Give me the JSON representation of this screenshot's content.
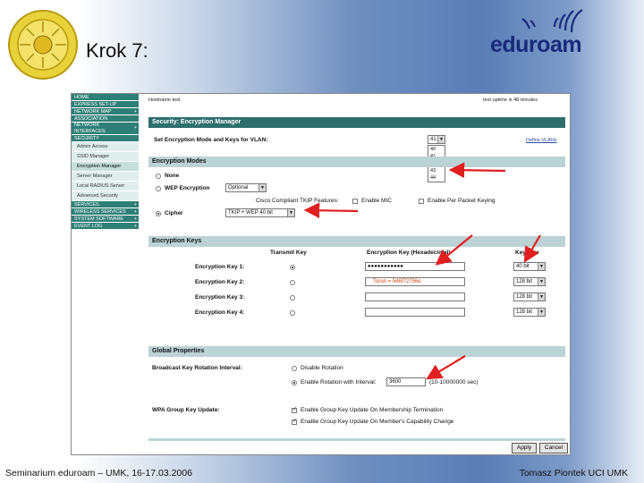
{
  "slide": {
    "title": "Krok 7:",
    "brand": "eduroam",
    "footer_left": "Seminarium eduroam – UMK, 16-17.03.2006",
    "footer_right": "Tomasz Piontek UCI UMK"
  },
  "sidebar": {
    "items": [
      {
        "label": "HOME",
        "plus": ""
      },
      {
        "label": "EXPRESS SET-UP",
        "plus": ""
      },
      {
        "label": "NETWORK MAP",
        "plus": "+"
      },
      {
        "label": "ASSOCIATION",
        "plus": ""
      },
      {
        "label": "NETWORK INTERFACES",
        "plus": "+"
      },
      {
        "label": "SECURITY",
        "plus": ""
      }
    ],
    "sub_items": [
      {
        "label": "Admin Access"
      },
      {
        "label": "SSID Manager"
      },
      {
        "label": "Encryption Manager"
      },
      {
        "label": "Server Manager"
      },
      {
        "label": "Local RADIUS Server"
      },
      {
        "label": "Advanced Security"
      }
    ],
    "items_bottom": [
      {
        "label": "SERVICES",
        "plus": "+"
      },
      {
        "label": "WIRELESS SERVICES",
        "plus": "+"
      },
      {
        "label": "SYSTEM SOFTWARE",
        "plus": "+"
      },
      {
        "label": "EVENT LOG",
        "plus": "+"
      }
    ]
  },
  "header": {
    "hostname": "Hostname  test",
    "uptime": "test uptime is 48 minutes"
  },
  "security": {
    "title": "Security: Encryption Manager",
    "vlan_label": "Set Encryption Mode and Keys for VLAN:",
    "vlan_selected": "41",
    "vlan_options": [
      "40",
      "41",
      "42",
      "43",
      "44"
    ],
    "vlan_highlighted": "42",
    "define_vlans": "Define VLANs"
  },
  "modes": {
    "title": "Encryption Modes",
    "none": "None",
    "wep": "WEP Encryption",
    "wep_value": "Optional",
    "cisco": "Cisco Compliant TKIP Features:",
    "enable_mic": "Enable MIC",
    "enable_per_packet": "Enable Per Packet Keying",
    "cipher": "Cipher",
    "cipher_value": "TKIP + WEP 40 bit"
  },
  "keys": {
    "title": "Encryption Keys",
    "col_transmit": "Transmit Key",
    "col_key": "Encryption Key (Hexadecimal)",
    "col_size": "Key Size",
    "rows": [
      {
        "label": "Encryption Key 1:",
        "value": "●●●●●●●●●●●",
        "size": "40 bit",
        "selected": true
      },
      {
        "label": "Encryption Key 2:",
        "value": "Torun = 546f72756e",
        "size": "128 bit",
        "selected": false
      },
      {
        "label": "Encryption Key 3:",
        "value": "",
        "size": "128 bit",
        "selected": false
      },
      {
        "label": "Encryption Key 4:",
        "value": "",
        "size": "128 bit",
        "selected": false
      }
    ]
  },
  "global": {
    "title": "Global Properties",
    "rotation_label": "Broadcast Key Rotation Interval:",
    "disable_rotation": "Disable Rotation",
    "enable_rotation": "Enable Rotation with Interval:",
    "interval": "3600",
    "interval_hint": "(10-10000000 sec)",
    "wpa_label": "WPA Group Key Update:",
    "wpa_opt1": "Enable Group Key Update On Membership Termination",
    "wpa_opt2": "Enable Group Key Update On Member's Capability Change"
  },
  "buttons": {
    "apply": "Apply",
    "cancel": "Cancel"
  },
  "colors": {
    "nav": "#2e7f76",
    "section": "#bcd3d5",
    "arrow": "#e02020",
    "brand": "#1a2a7a"
  }
}
